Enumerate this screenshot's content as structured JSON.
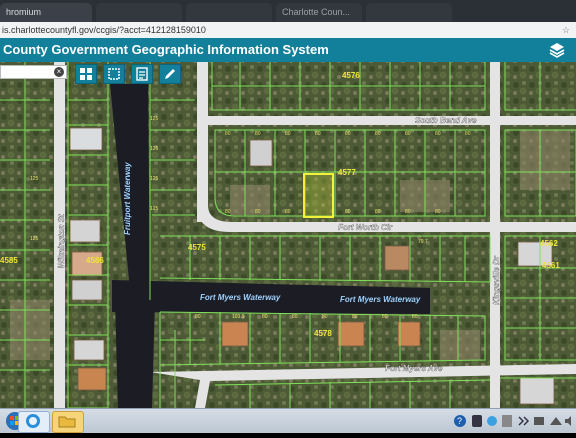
{
  "browser": {
    "tab_title": "hromium",
    "tab2": "",
    "tab3": "",
    "tab4": "Charlotte Coun...",
    "tab5": "",
    "url": "is.charlottecountyfl.gov/ccgis/?acct=412128159010"
  },
  "app": {
    "title": "County Government Geographic Information System"
  },
  "map": {
    "streets": {
      "south_bend": "South Bend Ave",
      "fort_worth": "Fort Worth Cir",
      "fort_myers_ave": "Fort Myers Ave",
      "kingsville": "Kingsville Dr",
      "wilmington": "Wilmington St"
    },
    "waterways": {
      "fruitport": "Fruitport Waterway",
      "fort_myers_1": "Fort Myers Waterway",
      "fort_myers_2": "Fort Myers Waterway"
    },
    "blocks": {
      "b4576": "4576",
      "b4577": "4577",
      "b4575": "4575",
      "b4578": "4578",
      "b4586": "4586",
      "b4562": "4562",
      "b4561": "4561",
      "b4585": "4585"
    },
    "lot_labels": [
      "80",
      "80",
      "80",
      "80",
      "80",
      "80",
      "80",
      "80",
      "80",
      "79.7",
      "80",
      "80",
      "80",
      "80",
      "80",
      "80",
      "80",
      "103.9",
      "80",
      "80",
      "80",
      "80",
      "80",
      "80",
      "80",
      "125",
      "125",
      "125",
      "125",
      "125",
      "125"
    ]
  },
  "colors": {
    "appbar": "#127f9b",
    "parcel_line": "#7fe05a",
    "selected_parcel": "#f2f23a",
    "road": "#e6e6e6",
    "water": "#1d1d26"
  }
}
